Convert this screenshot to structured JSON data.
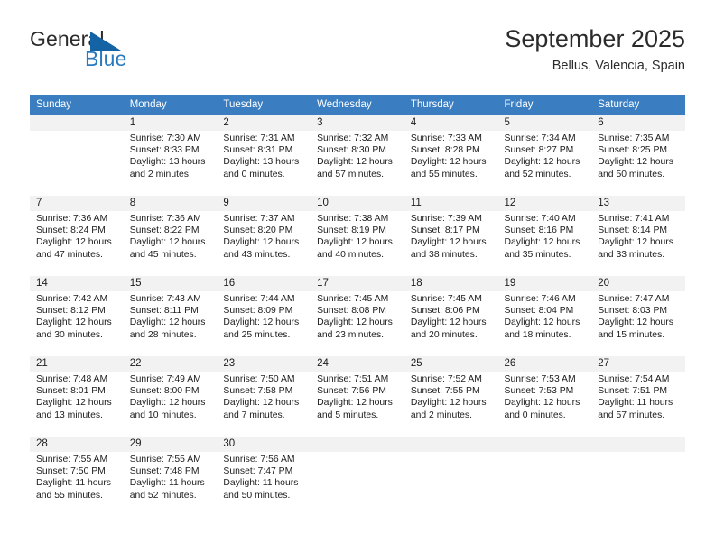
{
  "brand": {
    "general": "General",
    "blue": "Blue",
    "triangle_color": "#1464a5",
    "blue_color": "#2a7ac0"
  },
  "header": {
    "title": "September 2025",
    "subtitle": "Bellus, Valencia, Spain"
  },
  "calendar": {
    "header_bg": "#3a7dc0",
    "daynum_bg": "#f2f2f2",
    "weekdays": [
      "Sunday",
      "Monday",
      "Tuesday",
      "Wednesday",
      "Thursday",
      "Friday",
      "Saturday"
    ],
    "weeks": [
      [
        {
          "day": "",
          "sunrise": "",
          "sunset": "",
          "daylight1": "",
          "daylight2": ""
        },
        {
          "day": "1",
          "sunrise": "Sunrise: 7:30 AM",
          "sunset": "Sunset: 8:33 PM",
          "daylight1": "Daylight: 13 hours",
          "daylight2": "and 2 minutes."
        },
        {
          "day": "2",
          "sunrise": "Sunrise: 7:31 AM",
          "sunset": "Sunset: 8:31 PM",
          "daylight1": "Daylight: 13 hours",
          "daylight2": "and 0 minutes."
        },
        {
          "day": "3",
          "sunrise": "Sunrise: 7:32 AM",
          "sunset": "Sunset: 8:30 PM",
          "daylight1": "Daylight: 12 hours",
          "daylight2": "and 57 minutes."
        },
        {
          "day": "4",
          "sunrise": "Sunrise: 7:33 AM",
          "sunset": "Sunset: 8:28 PM",
          "daylight1": "Daylight: 12 hours",
          "daylight2": "and 55 minutes."
        },
        {
          "day": "5",
          "sunrise": "Sunrise: 7:34 AM",
          "sunset": "Sunset: 8:27 PM",
          "daylight1": "Daylight: 12 hours",
          "daylight2": "and 52 minutes."
        },
        {
          "day": "6",
          "sunrise": "Sunrise: 7:35 AM",
          "sunset": "Sunset: 8:25 PM",
          "daylight1": "Daylight: 12 hours",
          "daylight2": "and 50 minutes."
        }
      ],
      [
        {
          "day": "7",
          "sunrise": "Sunrise: 7:36 AM",
          "sunset": "Sunset: 8:24 PM",
          "daylight1": "Daylight: 12 hours",
          "daylight2": "and 47 minutes."
        },
        {
          "day": "8",
          "sunrise": "Sunrise: 7:36 AM",
          "sunset": "Sunset: 8:22 PM",
          "daylight1": "Daylight: 12 hours",
          "daylight2": "and 45 minutes."
        },
        {
          "day": "9",
          "sunrise": "Sunrise: 7:37 AM",
          "sunset": "Sunset: 8:20 PM",
          "daylight1": "Daylight: 12 hours",
          "daylight2": "and 43 minutes."
        },
        {
          "day": "10",
          "sunrise": "Sunrise: 7:38 AM",
          "sunset": "Sunset: 8:19 PM",
          "daylight1": "Daylight: 12 hours",
          "daylight2": "and 40 minutes."
        },
        {
          "day": "11",
          "sunrise": "Sunrise: 7:39 AM",
          "sunset": "Sunset: 8:17 PM",
          "daylight1": "Daylight: 12 hours",
          "daylight2": "and 38 minutes."
        },
        {
          "day": "12",
          "sunrise": "Sunrise: 7:40 AM",
          "sunset": "Sunset: 8:16 PM",
          "daylight1": "Daylight: 12 hours",
          "daylight2": "and 35 minutes."
        },
        {
          "day": "13",
          "sunrise": "Sunrise: 7:41 AM",
          "sunset": "Sunset: 8:14 PM",
          "daylight1": "Daylight: 12 hours",
          "daylight2": "and 33 minutes."
        }
      ],
      [
        {
          "day": "14",
          "sunrise": "Sunrise: 7:42 AM",
          "sunset": "Sunset: 8:12 PM",
          "daylight1": "Daylight: 12 hours",
          "daylight2": "and 30 minutes."
        },
        {
          "day": "15",
          "sunrise": "Sunrise: 7:43 AM",
          "sunset": "Sunset: 8:11 PM",
          "daylight1": "Daylight: 12 hours",
          "daylight2": "and 28 minutes."
        },
        {
          "day": "16",
          "sunrise": "Sunrise: 7:44 AM",
          "sunset": "Sunset: 8:09 PM",
          "daylight1": "Daylight: 12 hours",
          "daylight2": "and 25 minutes."
        },
        {
          "day": "17",
          "sunrise": "Sunrise: 7:45 AM",
          "sunset": "Sunset: 8:08 PM",
          "daylight1": "Daylight: 12 hours",
          "daylight2": "and 23 minutes."
        },
        {
          "day": "18",
          "sunrise": "Sunrise: 7:45 AM",
          "sunset": "Sunset: 8:06 PM",
          "daylight1": "Daylight: 12 hours",
          "daylight2": "and 20 minutes."
        },
        {
          "day": "19",
          "sunrise": "Sunrise: 7:46 AM",
          "sunset": "Sunset: 8:04 PM",
          "daylight1": "Daylight: 12 hours",
          "daylight2": "and 18 minutes."
        },
        {
          "day": "20",
          "sunrise": "Sunrise: 7:47 AM",
          "sunset": "Sunset: 8:03 PM",
          "daylight1": "Daylight: 12 hours",
          "daylight2": "and 15 minutes."
        }
      ],
      [
        {
          "day": "21",
          "sunrise": "Sunrise: 7:48 AM",
          "sunset": "Sunset: 8:01 PM",
          "daylight1": "Daylight: 12 hours",
          "daylight2": "and 13 minutes."
        },
        {
          "day": "22",
          "sunrise": "Sunrise: 7:49 AM",
          "sunset": "Sunset: 8:00 PM",
          "daylight1": "Daylight: 12 hours",
          "daylight2": "and 10 minutes."
        },
        {
          "day": "23",
          "sunrise": "Sunrise: 7:50 AM",
          "sunset": "Sunset: 7:58 PM",
          "daylight1": "Daylight: 12 hours",
          "daylight2": "and 7 minutes."
        },
        {
          "day": "24",
          "sunrise": "Sunrise: 7:51 AM",
          "sunset": "Sunset: 7:56 PM",
          "daylight1": "Daylight: 12 hours",
          "daylight2": "and 5 minutes."
        },
        {
          "day": "25",
          "sunrise": "Sunrise: 7:52 AM",
          "sunset": "Sunset: 7:55 PM",
          "daylight1": "Daylight: 12 hours",
          "daylight2": "and 2 minutes."
        },
        {
          "day": "26",
          "sunrise": "Sunrise: 7:53 AM",
          "sunset": "Sunset: 7:53 PM",
          "daylight1": "Daylight: 12 hours",
          "daylight2": "and 0 minutes."
        },
        {
          "day": "27",
          "sunrise": "Sunrise: 7:54 AM",
          "sunset": "Sunset: 7:51 PM",
          "daylight1": "Daylight: 11 hours",
          "daylight2": "and 57 minutes."
        }
      ],
      [
        {
          "day": "28",
          "sunrise": "Sunrise: 7:55 AM",
          "sunset": "Sunset: 7:50 PM",
          "daylight1": "Daylight: 11 hours",
          "daylight2": "and 55 minutes."
        },
        {
          "day": "29",
          "sunrise": "Sunrise: 7:55 AM",
          "sunset": "Sunset: 7:48 PM",
          "daylight1": "Daylight: 11 hours",
          "daylight2": "and 52 minutes."
        },
        {
          "day": "30",
          "sunrise": "Sunrise: 7:56 AM",
          "sunset": "Sunset: 7:47 PM",
          "daylight1": "Daylight: 11 hours",
          "daylight2": "and 50 minutes."
        },
        {
          "day": "",
          "sunrise": "",
          "sunset": "",
          "daylight1": "",
          "daylight2": ""
        },
        {
          "day": "",
          "sunrise": "",
          "sunset": "",
          "daylight1": "",
          "daylight2": ""
        },
        {
          "day": "",
          "sunrise": "",
          "sunset": "",
          "daylight1": "",
          "daylight2": ""
        },
        {
          "day": "",
          "sunrise": "",
          "sunset": "",
          "daylight1": "",
          "daylight2": ""
        }
      ]
    ]
  }
}
